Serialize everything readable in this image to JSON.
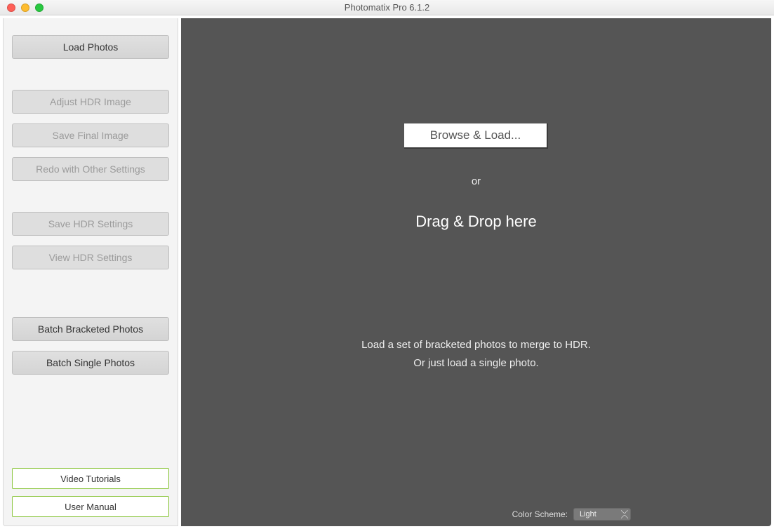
{
  "window": {
    "title": "Photomatix Pro 6.1.2"
  },
  "sidebar": {
    "load_photos": "Load Photos",
    "adjust_hdr": "Adjust HDR Image",
    "save_final": "Save Final Image",
    "redo_other": "Redo with Other Settings",
    "save_hdr_settings": "Save HDR Settings",
    "view_hdr_settings": "View HDR Settings",
    "batch_bracketed": "Batch Bracketed Photos",
    "batch_single": "Batch Single Photos",
    "video_tutorials": "Video Tutorials",
    "user_manual": "User Manual"
  },
  "main": {
    "browse_load": "Browse & Load...",
    "or": "or",
    "drag_drop": "Drag & Drop here",
    "hint1": "Load a set of bracketed photos to merge to HDR.",
    "hint2": "Or just load a single photo."
  },
  "footer": {
    "label": "Color Scheme:",
    "value": "Light"
  }
}
